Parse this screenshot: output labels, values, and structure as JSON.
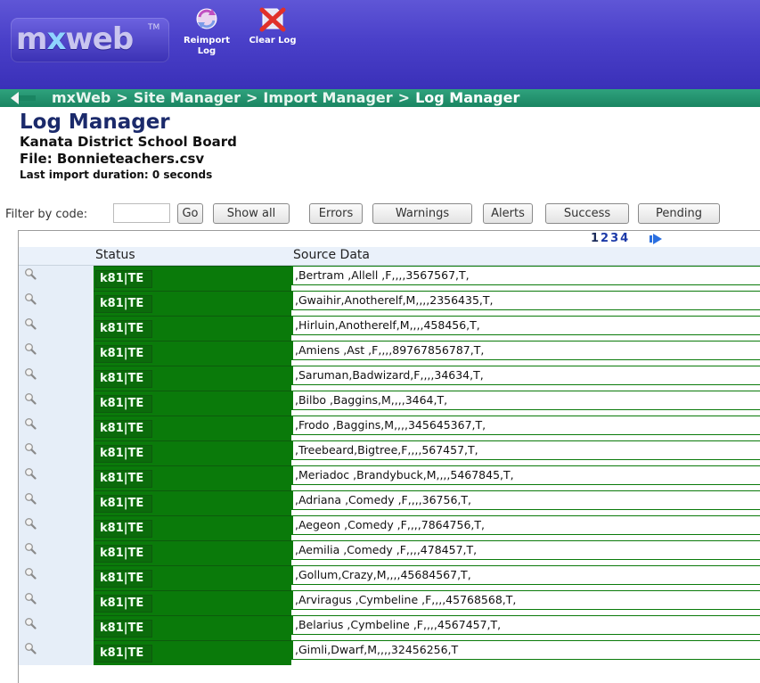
{
  "app": {
    "logo_text_a": "m",
    "logo_text_x": "x",
    "logo_text_b": "web",
    "logo_tm": "TM"
  },
  "toolbar": {
    "reimport_label": "Reimport Log",
    "clear_label": "Clear Log"
  },
  "breadcrumb": {
    "items": [
      "mxWeb",
      "Site Manager",
      "Import Manager"
    ],
    "current": "Log Manager",
    "separator": ">"
  },
  "header": {
    "title": "Log Manager",
    "board": "Kanata District School Board",
    "file": "File: Bonnieteachers.csv",
    "duration": "Last import duration: 0 seconds"
  },
  "filter": {
    "label": "Filter by code:",
    "value": "",
    "go_label": "Go",
    "buttons": [
      "Show all",
      "Errors",
      "Warnings",
      "Alerts",
      "Success",
      "Pending"
    ]
  },
  "pager": {
    "pages": [
      "1",
      "2",
      "3",
      "4"
    ],
    "current": "1"
  },
  "table": {
    "columns": [
      "Status",
      "Source Data"
    ],
    "status_color": "#0a7a0a",
    "rows": [
      {
        "status": "k81|TE",
        "source": ",Bertram ,Allell ,F,,,,3567567,T,"
      },
      {
        "status": "k81|TE",
        "source": ",Gwaihir,Anotherelf,M,,,,2356435,T,"
      },
      {
        "status": "k81|TE",
        "source": ",Hirluin,Anotherelf,M,,,,458456,T,"
      },
      {
        "status": "k81|TE",
        "source": ",Amiens ,Ast ,F,,,,89767856787,T,"
      },
      {
        "status": "k81|TE",
        "source": ",Saruman,Badwizard,F,,,,34634,T,"
      },
      {
        "status": "k81|TE",
        "source": ",Bilbo ,Baggins,M,,,,3464,T,"
      },
      {
        "status": "k81|TE",
        "source": ",Frodo ,Baggins,M,,,,345645367,T,"
      },
      {
        "status": "k81|TE",
        "source": ",Treebeard,Bigtree,F,,,,567457,T,"
      },
      {
        "status": "k81|TE",
        "source": ",Meriadoc ,Brandybuck,M,,,,5467845,T,"
      },
      {
        "status": "k81|TE",
        "source": ",Adriana ,Comedy ,F,,,,36756,T,"
      },
      {
        "status": "k81|TE",
        "source": ",Aegeon ,Comedy ,F,,,,7864756,T,"
      },
      {
        "status": "k81|TE",
        "source": ",Aemilia ,Comedy ,F,,,,478457,T,"
      },
      {
        "status": "k81|TE",
        "source": ",Gollum,Crazy,M,,,,45684567,T,"
      },
      {
        "status": "k81|TE",
        "source": ",Arviragus ,Cymbeline ,F,,,,45768568,T,"
      },
      {
        "status": "k81|TE",
        "source": ",Belarius ,Cymbeline ,F,,,,4567457,T,"
      },
      {
        "status": "k81|TE",
        "source": ",Gimli,Dwarf,M,,,,32456256,T"
      }
    ]
  }
}
